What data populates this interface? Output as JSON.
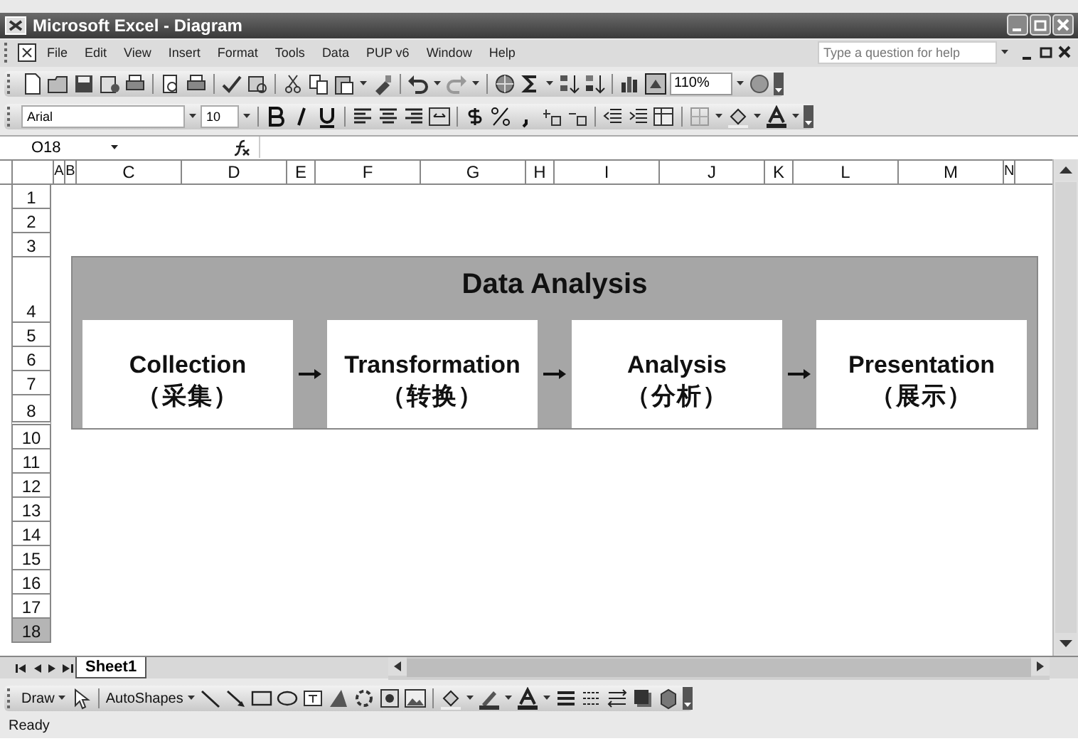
{
  "window": {
    "title": "Microsoft Excel - Diagram"
  },
  "menu": [
    "File",
    "Edit",
    "View",
    "Insert",
    "Format",
    "Tools",
    "Data",
    "PUP v6",
    "Window",
    "Help"
  ],
  "help_search": {
    "placeholder": "Type a question for help"
  },
  "toolbar": {
    "zoom": "110%"
  },
  "formatting": {
    "font": "Arial",
    "size": "10"
  },
  "name_box": "O18",
  "columns": [
    {
      "label": "A",
      "kind": "narrow"
    },
    {
      "label": "B",
      "kind": "narrow"
    },
    {
      "label": "C",
      "kind": "wide"
    },
    {
      "label": "D",
      "kind": "wide"
    },
    {
      "label": "E",
      "kind": "small"
    },
    {
      "label": "F",
      "kind": "wide"
    },
    {
      "label": "G",
      "kind": "wide"
    },
    {
      "label": "H",
      "kind": "small"
    },
    {
      "label": "I",
      "kind": "wide"
    },
    {
      "label": "J",
      "kind": "wide"
    },
    {
      "label": "K",
      "kind": "small"
    },
    {
      "label": "L",
      "kind": "wide"
    },
    {
      "label": "M",
      "kind": "wide"
    },
    {
      "label": "N",
      "kind": "narrow"
    }
  ],
  "rows": [
    {
      "label": "1",
      "kind": "normal",
      "selected": false
    },
    {
      "label": "2",
      "kind": "normal",
      "selected": false
    },
    {
      "label": "3",
      "kind": "normal",
      "selected": false
    },
    {
      "label": "4",
      "kind": "tall",
      "selected": false
    },
    {
      "label": "5",
      "kind": "normal",
      "selected": false
    },
    {
      "label": "6",
      "kind": "normal",
      "selected": false
    },
    {
      "label": "7",
      "kind": "normal",
      "selected": false
    },
    {
      "label": "8",
      "kind": "split",
      "selected": false
    },
    {
      "label": "10",
      "kind": "normal",
      "selected": false
    },
    {
      "label": "11",
      "kind": "normal",
      "selected": false
    },
    {
      "label": "12",
      "kind": "normal",
      "selected": false
    },
    {
      "label": "13",
      "kind": "normal",
      "selected": false
    },
    {
      "label": "14",
      "kind": "normal",
      "selected": false
    },
    {
      "label": "15",
      "kind": "normal",
      "selected": false
    },
    {
      "label": "16",
      "kind": "normal",
      "selected": false
    },
    {
      "label": "17",
      "kind": "normal",
      "selected": false
    },
    {
      "label": "18",
      "kind": "normal",
      "selected": true
    }
  ],
  "diagram": {
    "title": "Data Analysis",
    "steps": [
      {
        "label": "Collection",
        "sub": "（采集）"
      },
      {
        "label": "Transformation",
        "sub": "（转换）"
      },
      {
        "label": "Analysis",
        "sub": "（分析）"
      },
      {
        "label": "Presentation",
        "sub": "（展示）"
      }
    ]
  },
  "sheet_tabs": [
    {
      "label": "Sheet1",
      "selected": true
    }
  ],
  "drawing_toolbar": {
    "draw": "Draw",
    "autoshapes": "AutoShapes"
  },
  "status_bar": "Ready"
}
